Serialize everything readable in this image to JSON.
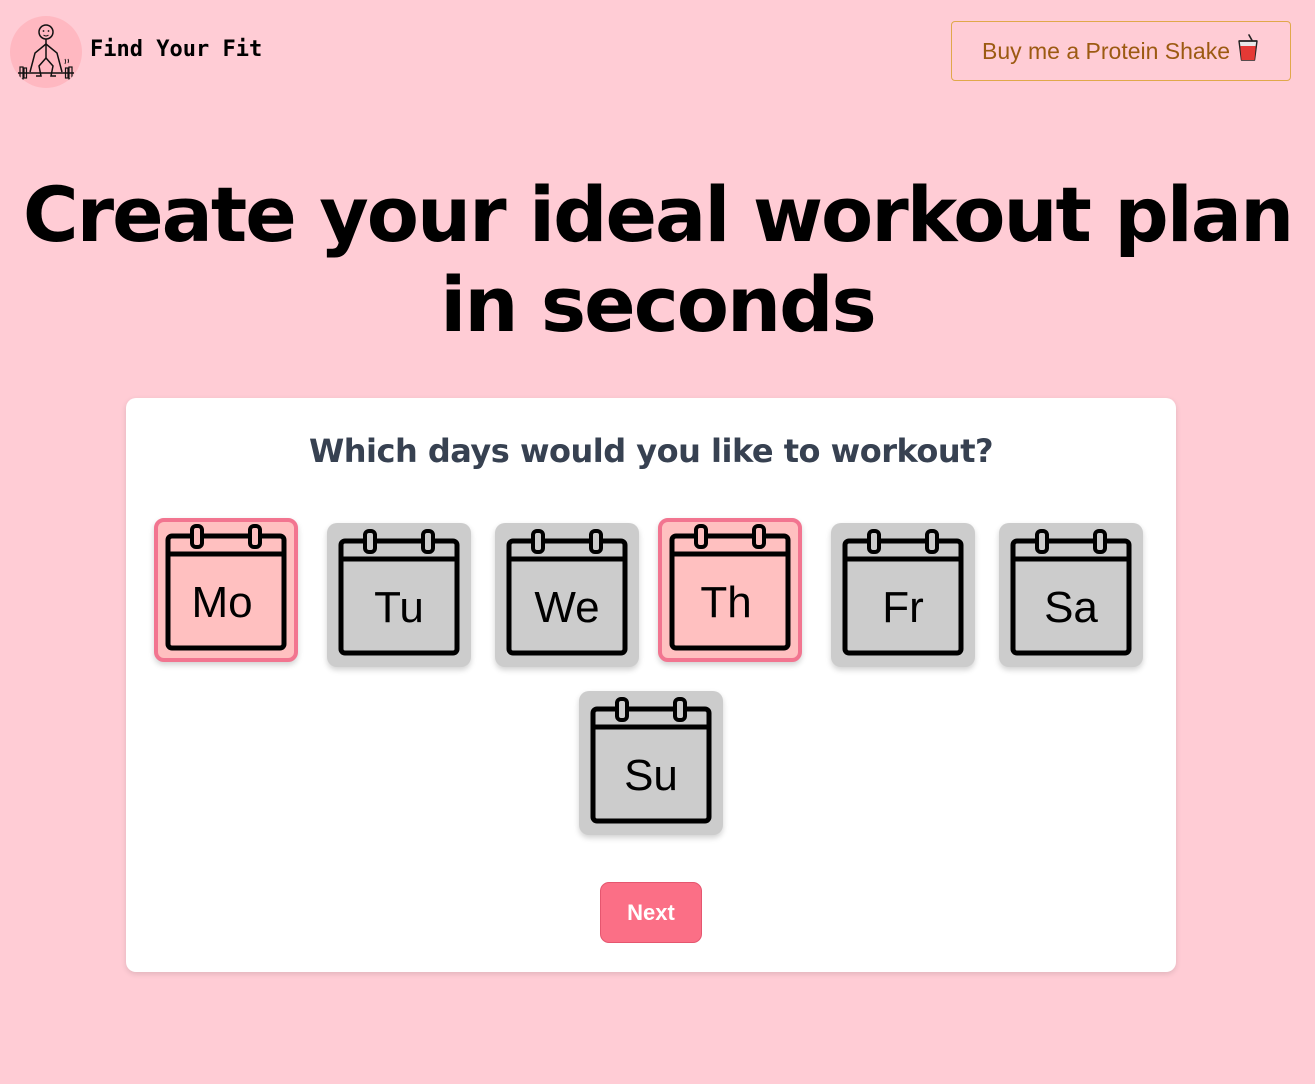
{
  "header": {
    "brand_name": "Find Your Fit",
    "logo_icon": "stick-figure-lifter-icon",
    "cta_label": "Buy me a Protein Shake",
    "cta_icon": "protein-shake-cup-icon"
  },
  "hero": {
    "line1": "Create your ideal workout plan",
    "line2": "in seconds"
  },
  "card": {
    "question": "Which days would you like to workout?",
    "days": [
      {
        "label": "Mo",
        "selected": true
      },
      {
        "label": "Tu",
        "selected": false
      },
      {
        "label": "We",
        "selected": false
      },
      {
        "label": "Th",
        "selected": true
      },
      {
        "label": "Fr",
        "selected": false
      },
      {
        "label": "Sa",
        "selected": false
      },
      {
        "label": "Su",
        "selected": false
      }
    ],
    "next_label": "Next"
  },
  "colors": {
    "page_bg": "#ffccd5",
    "selected_bg": "#ffc0c0",
    "selected_border": "#f27590",
    "unselected_bg": "#cccccc",
    "accent": "#fb6f86",
    "cta_text": "#9c5a12"
  }
}
